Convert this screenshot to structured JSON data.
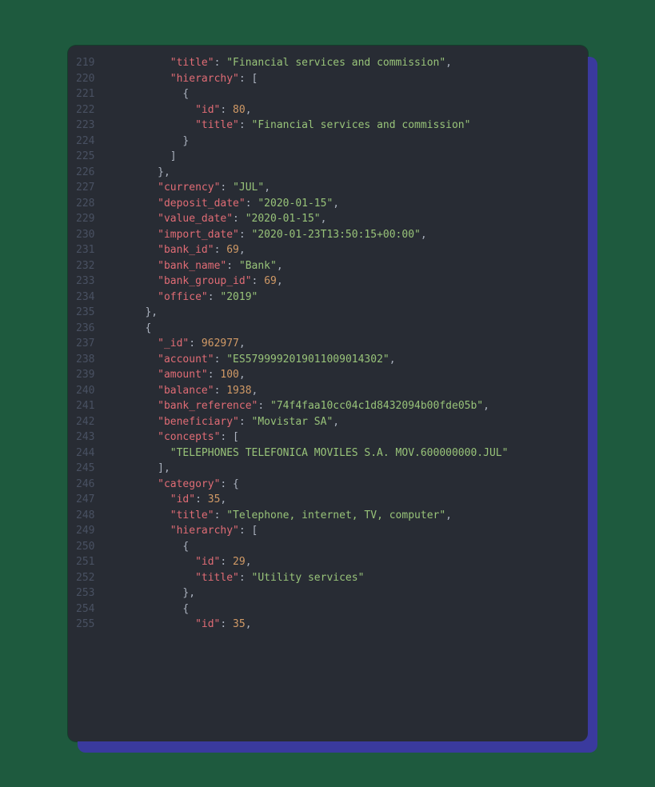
{
  "startLine": 219,
  "lines": [
    {
      "num": 219,
      "indent": 10,
      "tokens": [
        [
          "key",
          "\"title\""
        ],
        [
          "punct",
          ": "
        ],
        [
          "string",
          "\"Financial services and commission\""
        ],
        [
          "punct",
          ","
        ]
      ]
    },
    {
      "num": 220,
      "indent": 10,
      "tokens": [
        [
          "key",
          "\"hierarchy\""
        ],
        [
          "punct",
          ": ["
        ]
      ]
    },
    {
      "num": 221,
      "indent": 12,
      "tokens": [
        [
          "punct",
          "{"
        ]
      ]
    },
    {
      "num": 222,
      "indent": 14,
      "tokens": [
        [
          "key",
          "\"id\""
        ],
        [
          "punct",
          ": "
        ],
        [
          "num",
          "80"
        ],
        [
          "punct",
          ","
        ]
      ]
    },
    {
      "num": 223,
      "indent": 14,
      "tokens": [
        [
          "key",
          "\"title\""
        ],
        [
          "punct",
          ": "
        ],
        [
          "string",
          "\"Financial services and commission\""
        ]
      ]
    },
    {
      "num": 224,
      "indent": 12,
      "tokens": [
        [
          "punct",
          "}"
        ]
      ]
    },
    {
      "num": 225,
      "indent": 10,
      "tokens": [
        [
          "punct",
          "]"
        ]
      ]
    },
    {
      "num": 226,
      "indent": 8,
      "tokens": [
        [
          "punct",
          "},"
        ]
      ]
    },
    {
      "num": 227,
      "indent": 8,
      "tokens": [
        [
          "key",
          "\"currency\""
        ],
        [
          "punct",
          ": "
        ],
        [
          "string",
          "\"JUL\""
        ],
        [
          "punct",
          ","
        ]
      ]
    },
    {
      "num": 228,
      "indent": 8,
      "tokens": [
        [
          "key",
          "\"deposit_date\""
        ],
        [
          "punct",
          ": "
        ],
        [
          "string",
          "\"2020-01-15\""
        ],
        [
          "punct",
          ","
        ]
      ]
    },
    {
      "num": 229,
      "indent": 8,
      "tokens": [
        [
          "key",
          "\"value_date\""
        ],
        [
          "punct",
          ": "
        ],
        [
          "string",
          "\"2020-01-15\""
        ],
        [
          "punct",
          ","
        ]
      ]
    },
    {
      "num": 230,
      "indent": 8,
      "tokens": [
        [
          "key",
          "\"import_date\""
        ],
        [
          "punct",
          ": "
        ],
        [
          "string",
          "\"2020-01-23T13:50:15+00:00\""
        ],
        [
          "punct",
          ","
        ]
      ]
    },
    {
      "num": 231,
      "indent": 8,
      "tokens": [
        [
          "key",
          "\"bank_id\""
        ],
        [
          "punct",
          ": "
        ],
        [
          "num",
          "69"
        ],
        [
          "punct",
          ","
        ]
      ]
    },
    {
      "num": 232,
      "indent": 8,
      "tokens": [
        [
          "key",
          "\"bank_name\""
        ],
        [
          "punct",
          ": "
        ],
        [
          "string",
          "\"Bank\""
        ],
        [
          "punct",
          ","
        ]
      ]
    },
    {
      "num": 233,
      "indent": 8,
      "tokens": [
        [
          "key",
          "\"bank_group_id\""
        ],
        [
          "punct",
          ": "
        ],
        [
          "num",
          "69"
        ],
        [
          "punct",
          ","
        ]
      ]
    },
    {
      "num": 234,
      "indent": 8,
      "tokens": [
        [
          "key",
          "\"office\""
        ],
        [
          "punct",
          ": "
        ],
        [
          "string",
          "\"2019\""
        ]
      ]
    },
    {
      "num": 235,
      "indent": 6,
      "tokens": [
        [
          "punct",
          "},"
        ]
      ]
    },
    {
      "num": 236,
      "indent": 6,
      "tokens": [
        [
          "punct",
          "{"
        ]
      ]
    },
    {
      "num": 237,
      "indent": 8,
      "tokens": [
        [
          "key",
          "\"_id\""
        ],
        [
          "punct",
          ": "
        ],
        [
          "num",
          "962977"
        ],
        [
          "punct",
          ","
        ]
      ]
    },
    {
      "num": 238,
      "indent": 8,
      "tokens": [
        [
          "key",
          "\"account\""
        ],
        [
          "punct",
          ": "
        ],
        [
          "string",
          "\"ES5799992019011009014302\""
        ],
        [
          "punct",
          ","
        ]
      ]
    },
    {
      "num": 239,
      "indent": 8,
      "tokens": [
        [
          "key",
          "\"amount\""
        ],
        [
          "punct",
          ": "
        ],
        [
          "num",
          "100"
        ],
        [
          "punct",
          ","
        ]
      ]
    },
    {
      "num": 240,
      "indent": 8,
      "tokens": [
        [
          "key",
          "\"balance\""
        ],
        [
          "punct",
          ": "
        ],
        [
          "num",
          "1938"
        ],
        [
          "punct",
          ","
        ]
      ]
    },
    {
      "num": 241,
      "indent": 8,
      "tokens": [
        [
          "key",
          "\"bank_reference\""
        ],
        [
          "punct",
          ": "
        ],
        [
          "string",
          "\"74f4faa10cc04c1d8432094b00fde05b\""
        ],
        [
          "punct",
          ","
        ]
      ]
    },
    {
      "num": 242,
      "indent": 8,
      "tokens": [
        [
          "key",
          "\"beneficiary\""
        ],
        [
          "punct",
          ": "
        ],
        [
          "string",
          "\"Movistar SA\""
        ],
        [
          "punct",
          ","
        ]
      ]
    },
    {
      "num": 243,
      "indent": 8,
      "tokens": [
        [
          "key",
          "\"concepts\""
        ],
        [
          "punct",
          ": ["
        ]
      ]
    },
    {
      "num": 244,
      "indent": 10,
      "tokens": [
        [
          "string",
          "\"TELEPHONES TELEFONICA MOVILES S.A. MOV.600000000.JUL\""
        ]
      ]
    },
    {
      "num": 245,
      "indent": 8,
      "tokens": [
        [
          "punct",
          "],"
        ]
      ]
    },
    {
      "num": 246,
      "indent": 8,
      "tokens": [
        [
          "key",
          "\"category\""
        ],
        [
          "punct",
          ": {"
        ]
      ]
    },
    {
      "num": 247,
      "indent": 10,
      "tokens": [
        [
          "key",
          "\"id\""
        ],
        [
          "punct",
          ": "
        ],
        [
          "num",
          "35"
        ],
        [
          "punct",
          ","
        ]
      ]
    },
    {
      "num": 248,
      "indent": 10,
      "tokens": [
        [
          "key",
          "\"title\""
        ],
        [
          "punct",
          ": "
        ],
        [
          "string",
          "\"Telephone, internet, TV, computer\""
        ],
        [
          "punct",
          ","
        ]
      ]
    },
    {
      "num": 249,
      "indent": 10,
      "tokens": [
        [
          "key",
          "\"hierarchy\""
        ],
        [
          "punct",
          ": ["
        ]
      ]
    },
    {
      "num": 250,
      "indent": 12,
      "tokens": [
        [
          "punct",
          "{"
        ]
      ]
    },
    {
      "num": 251,
      "indent": 14,
      "tokens": [
        [
          "key",
          "\"id\""
        ],
        [
          "punct",
          ": "
        ],
        [
          "num",
          "29"
        ],
        [
          "punct",
          ","
        ]
      ]
    },
    {
      "num": 252,
      "indent": 14,
      "tokens": [
        [
          "key",
          "\"title\""
        ],
        [
          "punct",
          ": "
        ],
        [
          "string",
          "\"Utility services\""
        ]
      ]
    },
    {
      "num": 253,
      "indent": 12,
      "tokens": [
        [
          "punct",
          "},"
        ]
      ]
    },
    {
      "num": 254,
      "indent": 12,
      "tokens": [
        [
          "punct",
          "{"
        ]
      ]
    },
    {
      "num": 255,
      "indent": 14,
      "tokens": [
        [
          "key",
          "\"id\""
        ],
        [
          "punct",
          ": "
        ],
        [
          "num",
          "35"
        ],
        [
          "punct",
          ","
        ]
      ]
    }
  ]
}
